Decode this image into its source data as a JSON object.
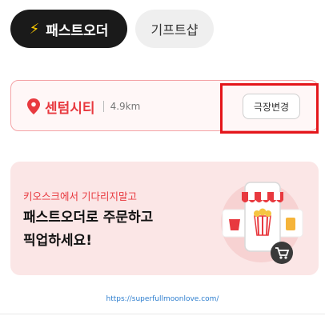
{
  "tabs": {
    "fast_order": {
      "label": "패스트오더",
      "icon": "lightning-icon"
    },
    "gift_shop": {
      "label": "기프트샵"
    }
  },
  "theater": {
    "icon": "location-pin-icon",
    "name": "센텀시티",
    "distance": "4.9km",
    "change_label": "극장변경"
  },
  "banner": {
    "subtitle": "키오스크에서 기다리지말고",
    "title_line1": "패스트오더로 주문하고",
    "title_line2": "픽업하세요!"
  },
  "watermark": "https://superfullmoonlove.com/",
  "colors": {
    "accent": "#e8393f",
    "highlight_box": "#e4161b",
    "active_tab": "#1a1a1a",
    "banner_bg": "#fbe6e6"
  }
}
